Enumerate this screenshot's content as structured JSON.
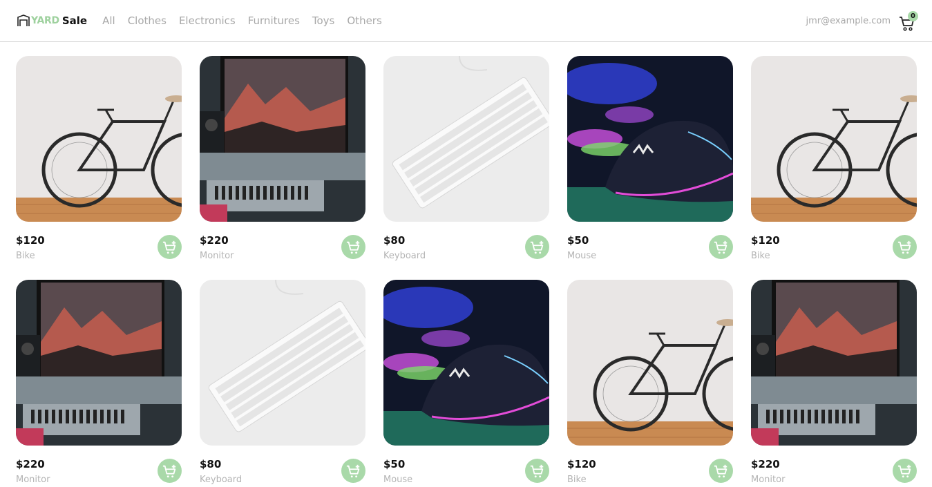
{
  "brand": {
    "yard": "YARD",
    "sale": "Sale"
  },
  "nav": {
    "links": [
      "All",
      "Clothes",
      "Electronics",
      "Furnitures",
      "Toys",
      "Others"
    ]
  },
  "user": {
    "email": "jmr@example.com"
  },
  "cart": {
    "count": "0"
  },
  "colors": {
    "accent": "#a9d9a9",
    "muted_text": "#a8a8a8",
    "price_text": "#111111"
  },
  "products": [
    {
      "price": "$120",
      "name": "Bike",
      "image": "bike"
    },
    {
      "price": "$220",
      "name": "Monitor",
      "image": "monitor"
    },
    {
      "price": "$80",
      "name": "Keyboard",
      "image": "keyboard"
    },
    {
      "price": "$50",
      "name": "Mouse",
      "image": "mouse"
    },
    {
      "price": "$120",
      "name": "Bike",
      "image": "bike"
    },
    {
      "price": "$220",
      "name": "Monitor",
      "image": "monitor"
    },
    {
      "price": "$80",
      "name": "Keyboard",
      "image": "keyboard"
    },
    {
      "price": "$50",
      "name": "Mouse",
      "image": "mouse"
    },
    {
      "price": "$120",
      "name": "Bike",
      "image": "bike"
    },
    {
      "price": "$220",
      "name": "Monitor",
      "image": "monitor"
    }
  ]
}
